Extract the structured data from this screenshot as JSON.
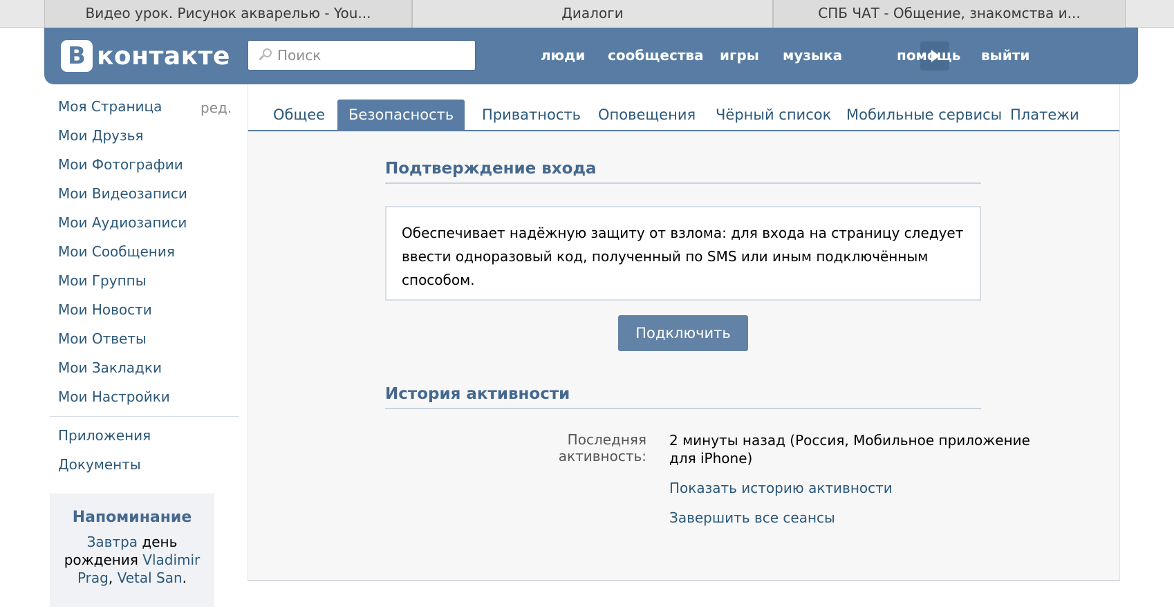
{
  "browser": {
    "tabs": [
      {
        "label": "Видео урок. Рисунок акварелью - You..."
      },
      {
        "label": "Диалоги"
      },
      {
        "label": "СПБ ЧАТ - Общение, знакомства и..."
      }
    ]
  },
  "header": {
    "logo_badge": "В",
    "logo_text": "контакте",
    "search_placeholder": "Поиск",
    "nav": {
      "people": "люди",
      "communities": "сообщества",
      "games": "игры",
      "music": "музыка",
      "help": "помощь",
      "logout": "выйти"
    }
  },
  "sidebar": {
    "items": [
      {
        "label": "Моя Страница"
      },
      {
        "label": "Мои Друзья"
      },
      {
        "label": "Мои Фотографии"
      },
      {
        "label": "Мои Видеозаписи"
      },
      {
        "label": "Мои Аудиозаписи"
      },
      {
        "label": "Мои Сообщения"
      },
      {
        "label": "Мои Группы"
      },
      {
        "label": "Мои Новости"
      },
      {
        "label": "Мои Ответы"
      },
      {
        "label": "Мои Закладки"
      },
      {
        "label": "Мои Настройки"
      }
    ],
    "edit_label": "ред.",
    "extra_items": [
      {
        "label": "Приложения"
      },
      {
        "label": "Документы"
      }
    ],
    "reminder": {
      "title": "Напоминание",
      "tomorrow": "Завтра",
      "text_1": " день рождения ",
      "person_1": "Vladimir Prag",
      "sep": ", ",
      "person_2": "Vetal San",
      "end": "."
    }
  },
  "settings": {
    "tabs": [
      {
        "label": "Общее"
      },
      {
        "label": "Безопасность"
      },
      {
        "label": "Приватность"
      },
      {
        "label": "Оповещения"
      },
      {
        "label": "Чёрный список"
      },
      {
        "label": "Мобильные сервисы"
      },
      {
        "label": "Платежи"
      }
    ],
    "active_tab": "Безопасность",
    "login_confirm": {
      "title": "Подтверждение входа",
      "description": "Обеспечивает надёжную защиту от взлома: для входа на страницу следует ввести одноразовый код, полученный по SMS или иным подключённым способом.",
      "button": "Подключить"
    },
    "activity": {
      "title": "История активности",
      "last_label": "Последняя активность:",
      "last_value": "2 минуты назад (Россия, Мобильное приложение для iPhone)",
      "show_history": "Показать историю активности",
      "end_sessions": "Завершить все сеансы"
    }
  },
  "colors": {
    "header_bg": "#587ca3",
    "link": "#2b587a",
    "section_title": "#45688e",
    "button_bg": "#6282a6"
  }
}
